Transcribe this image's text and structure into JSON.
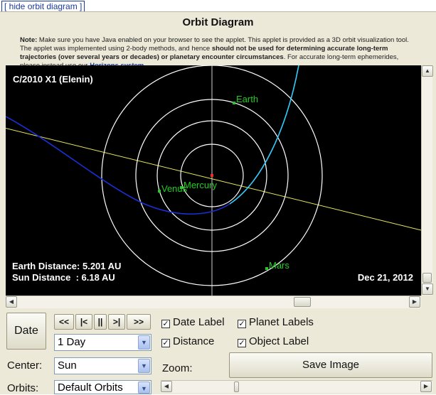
{
  "hide_link": "[ hide orbit diagram ]",
  "title": "Orbit Diagram",
  "note": {
    "label": "Note:",
    "text1": " Make sure you have Java enabled on your browser to see the applet. This applet is provided as a 3D orbit visualization tool. The applet was implemented using 2-body methods, and hence ",
    "bold": "should not be used for determining accurate long-term trajectories (over several years or decades) or planetary encounter circumstances",
    "text2": ". For accurate long-term ephemerides, please instead use our ",
    "link": "Horizons system",
    "text3": "."
  },
  "diagram": {
    "object_name": "C/2010 X1 (Elenin)",
    "earth_distance": "Earth Distance: 5.201 AU",
    "sun_distance": "Sun Distance  : 6.18 AU",
    "date": "Dec 21, 2012",
    "planets": {
      "earth": "Earth",
      "venus": "Venus",
      "mercury": "Mercury",
      "mars": "Mars"
    },
    "colors": {
      "background": "#000000",
      "orbit": "#ffffff",
      "planet": "#22cc22",
      "comet_above": "#33ccff",
      "comet_below": "#1a2fd6",
      "ecliptic_line": "#e8e85a",
      "sun": "#ff2222"
    }
  },
  "controls": {
    "date_button": "Date",
    "nav": {
      "rewind_fast": "<<",
      "step_back": "|<",
      "pause": "||",
      "step_forward": ">|",
      "forward_fast": ">>"
    },
    "step_select": "1 Day",
    "center_label": "Center:",
    "center_select": "Sun",
    "orbits_label": "Orbits:",
    "orbits_select": "Default Orbits",
    "zoom_label": "Zoom:",
    "date_label": "Date Label",
    "planet_labels": "Planet Labels",
    "distance": "Distance",
    "object_label": "Object Label",
    "save_image": "Save Image",
    "check_mark": "✓"
  }
}
